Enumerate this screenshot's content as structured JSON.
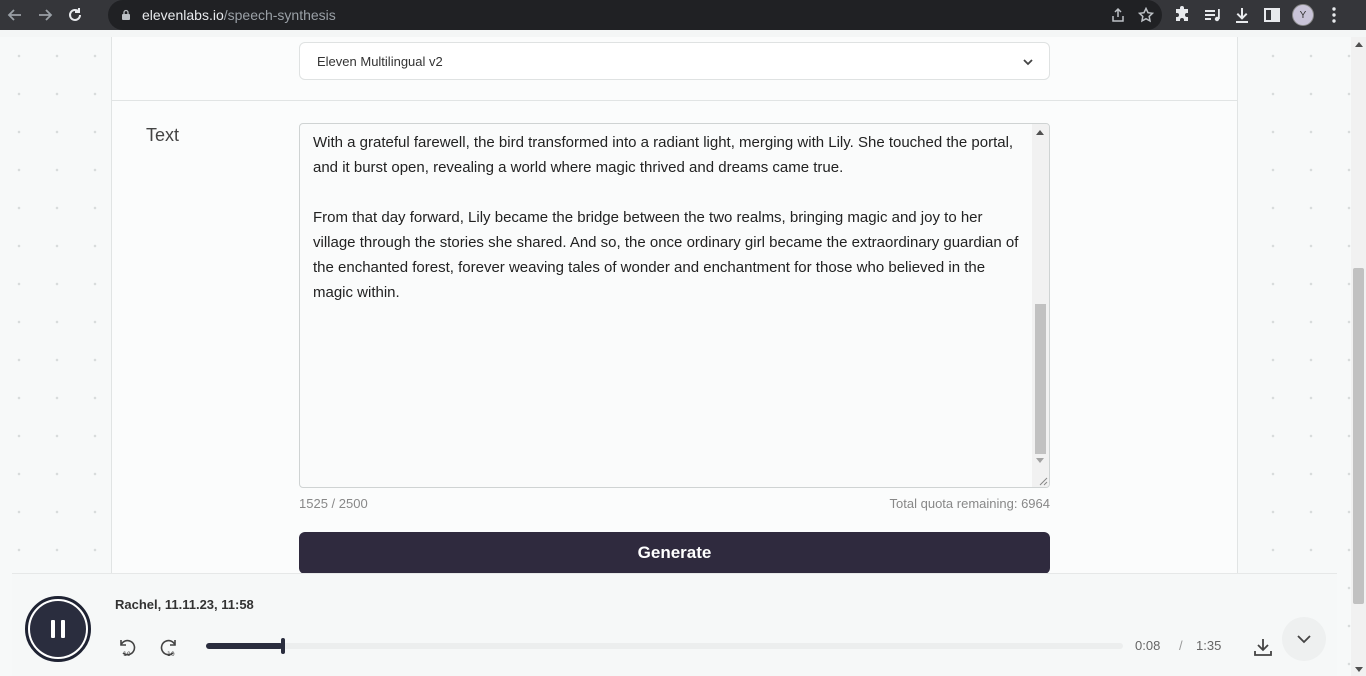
{
  "browser": {
    "url_domain": "elevenlabs.io",
    "url_path": "/speech-synthesis",
    "profile_initial": "Y"
  },
  "settings": {
    "model_selected": "Eleven Multilingual v2"
  },
  "editor": {
    "label": "Text",
    "text": "With a grateful farewell, the bird transformed into a radiant light, merging with Lily. She touched the portal, and it burst open, revealing a world where magic thrived and dreams came true.\n\nFrom that day forward, Lily became the bridge between the two realms, bringing magic and joy to her village through the stories she shared. And so, the once ordinary girl became the extraordinary guardian of the enchanted forest, forever weaving tales of wonder and enchantment for those who believed in the magic within.",
    "char_count": "1525 / 2500",
    "quota": "Total quota remaining: 6964",
    "generate_label": "Generate"
  },
  "player": {
    "title": "Rachel, 11.11.23, 11:58",
    "current_time": "0:08",
    "separator": "/",
    "duration": "1:35",
    "progress": 0.084,
    "state": "playing"
  },
  "icons": {
    "back": "arrow-left-icon",
    "forward": "arrow-right-icon",
    "reload": "reload-icon",
    "lock": "lock-icon",
    "share": "share-icon",
    "bookmark": "star-icon",
    "extensions": "puzzle-icon",
    "media": "media-queue-icon",
    "downloads": "download-icon",
    "sidepanel": "side-panel-icon",
    "menu": "kebab-menu-icon",
    "pause": "pause-icon",
    "rewind": "rewind-10-icon",
    "skip": "forward-10-icon",
    "collapse": "chevron-down-icon"
  },
  "colors": {
    "primary_button": "#2f2a3e",
    "player_accent": "#2a2d3e"
  }
}
